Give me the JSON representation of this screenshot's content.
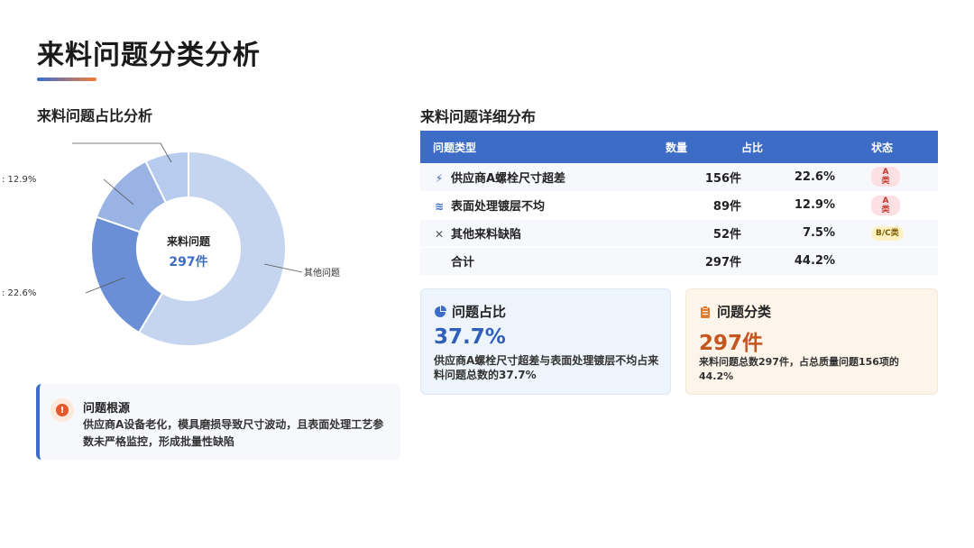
{
  "page": {
    "title": "来料问题分类分析"
  },
  "left": {
    "section_title": "来料问题占比分析"
  },
  "chart_data": {
    "type": "pie",
    "donut": true,
    "center_label": "来料问题",
    "center_value": "297件",
    "slices": [
      {
        "label": "其他问题",
        "value": 60.6,
        "color": "#c6d5ef"
      },
      {
        "label": "",
        "label_suffix": ": 22.6%",
        "value": 22.6,
        "color": "#6a8fd6"
      },
      {
        "label": "",
        "label_suffix": ": 12.9%",
        "value": 12.9,
        "color": "#98b3e4"
      },
      {
        "label": "",
        "label_suffix": "",
        "value": 7.5,
        "color": "#b6cbee"
      }
    ]
  },
  "root_cause": {
    "title": "问题根源",
    "text": "供应商A设备老化，模具磨损导致尺寸波动，且表面处理工艺参数未严格监控，形成批量性缺陷",
    "icon": "!"
  },
  "right": {
    "section_title": "来料问题详细分布"
  },
  "table": {
    "headers": {
      "type": "问题类型",
      "count": "数量",
      "pct": "占比",
      "status": "状态"
    },
    "rows": [
      {
        "icon": "bolt-icon",
        "glyph": "⚡",
        "type": "供应商A螺栓尺寸超差",
        "count": "156件",
        "pct": "22.6%",
        "status": "A\n类",
        "status_kind": "a"
      },
      {
        "icon": "layers-icon",
        "glyph": "≋",
        "type": "表面处理镀层不均",
        "count": "89件",
        "pct": "12.9%",
        "status": "A\n类",
        "status_kind": "a"
      },
      {
        "icon": "tools-icon",
        "glyph": "✕",
        "type": "其他来料缺陷",
        "count": "52件",
        "pct": "7.5%",
        "status": "B/C类",
        "status_kind": "bc"
      }
    ],
    "total": {
      "label": "合计",
      "count": "297件",
      "pct": "44.2%"
    }
  },
  "cards": {
    "ratio": {
      "title": "问题占比",
      "value": "37.7%",
      "desc": "供应商A螺栓尺寸超差与表面处理镀层不均占来料问题总数的37.7%"
    },
    "classification": {
      "title": "问题分类",
      "value": "297件",
      "desc": "来料问题总数297件，占总质量问题156项的44.2%"
    }
  },
  "colors": {
    "accent": "#3d6cc7",
    "orange": "#e4582b",
    "card_orange": "#c4561f"
  }
}
